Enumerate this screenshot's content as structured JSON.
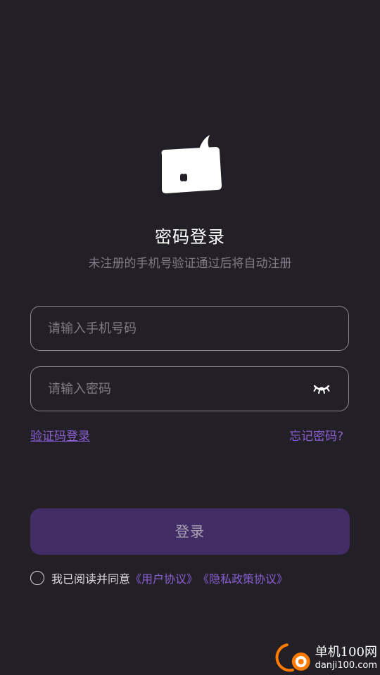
{
  "header": {
    "logo_icon": "chat-bubble-mascot-icon",
    "title": "密码登录",
    "subtitle": "未注册的手机号验证通过后将自动注册"
  },
  "form": {
    "phone_placeholder": "请输入手机号码",
    "phone_value": "",
    "password_placeholder": "请输入密码",
    "password_value": "",
    "eye_icon": "eye-closed-icon"
  },
  "links": {
    "sms_login": "验证码登录",
    "forgot_password": "忘记密码?"
  },
  "login_button": {
    "label": "登录"
  },
  "agreement": {
    "checked": false,
    "prefix": "我已阅读并同意",
    "user_agreement": "《用户协议》",
    "privacy_policy": "《隐私政策协议》"
  },
  "watermark": {
    "name": "单机100网",
    "domain": "danji100.com"
  },
  "colors": {
    "background": "#221f26",
    "accent": "#8a5fd3",
    "button_bg": "#432d66",
    "placeholder": "#807b87"
  }
}
